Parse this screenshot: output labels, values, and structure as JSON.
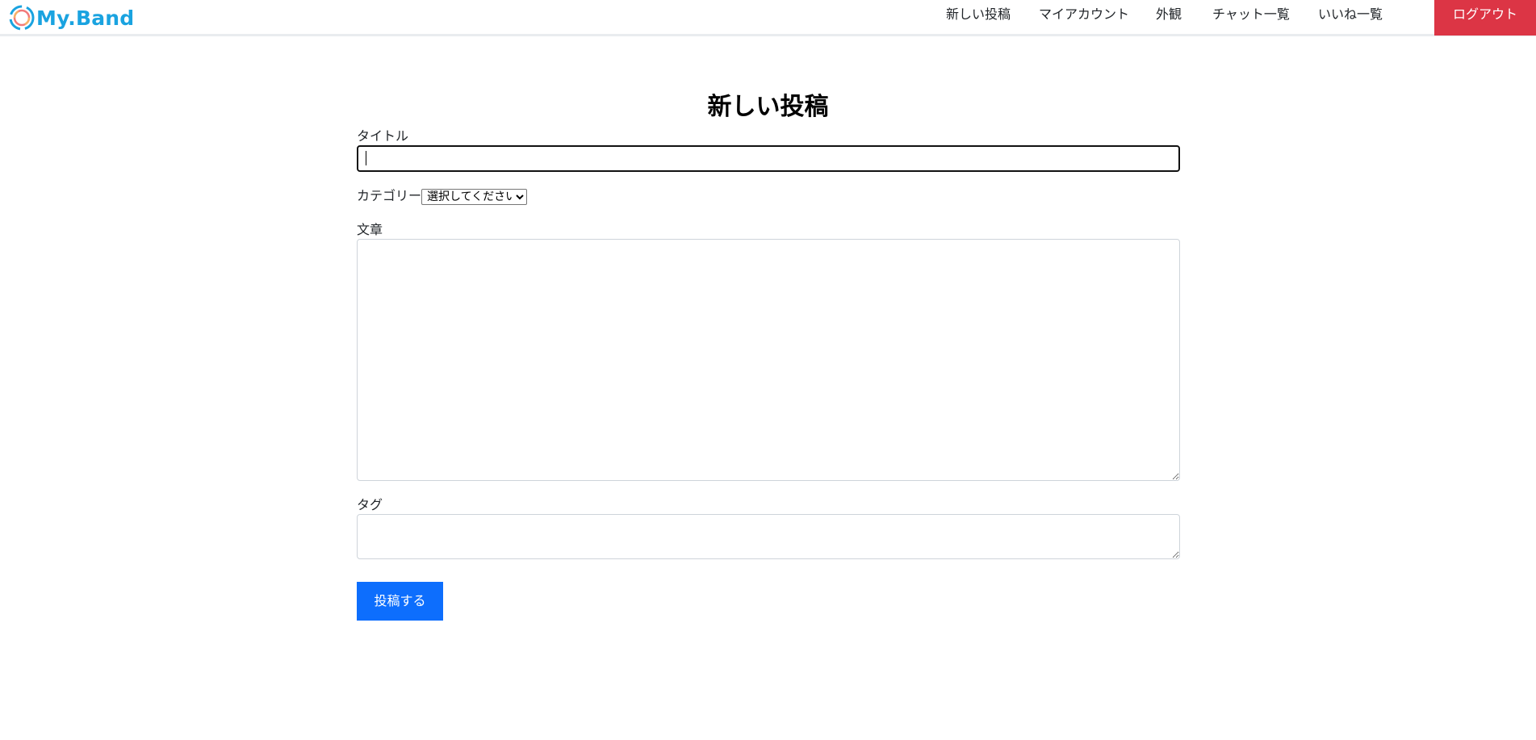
{
  "header": {
    "logo_text": "My.Band",
    "brand_color": "#1aa3e0",
    "nav": {
      "new_post": "新しい投稿",
      "my_account": "マイアカウント",
      "appearance": "外観",
      "chat_list": "チャット一覧",
      "likes_list": "いいね一覧"
    },
    "logout_label": "ログアウト",
    "logout_color": "#dc3545"
  },
  "form": {
    "page_title": "新しい投稿",
    "title_label": "タイトル",
    "title_value": "",
    "category_label": "カテゴリー",
    "category_selected": "選択してください",
    "body_label": "文章",
    "body_value": "",
    "tag_label": "タグ",
    "tag_value": "",
    "submit_label": "投稿する",
    "submit_color": "#0d6efd"
  }
}
